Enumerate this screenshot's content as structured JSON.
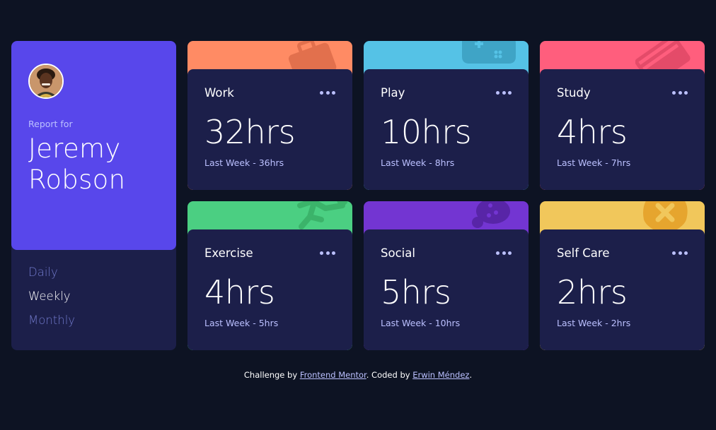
{
  "profile": {
    "report_label": "Report for",
    "first_name": "Jeremy",
    "last_name": "Robson",
    "avatar_icon": "user-avatar-photo"
  },
  "tabs": [
    {
      "label": "Daily",
      "active": false
    },
    {
      "label": "Weekly",
      "active": true
    },
    {
      "label": "Monthly",
      "active": false
    }
  ],
  "cards": [
    {
      "title": "Work",
      "current": "32hrs",
      "previous": "Last Week - 36hrs",
      "color": "#ff8b64",
      "icon": "briefcase-icon"
    },
    {
      "title": "Play",
      "current": "10hrs",
      "previous": "Last Week - 8hrs",
      "color": "#55c2e6",
      "icon": "gamepad-icon"
    },
    {
      "title": "Study",
      "current": "4hrs",
      "previous": "Last Week - 7hrs",
      "color": "#ff5e7d",
      "icon": "books-icon"
    },
    {
      "title": "Exercise",
      "current": "4hrs",
      "previous": "Last Week - 5hrs",
      "color": "#4bcf82",
      "icon": "running-icon"
    },
    {
      "title": "Social",
      "current": "5hrs",
      "previous": "Last Week - 10hrs",
      "color": "#7335d2",
      "icon": "chat-bubble-icon"
    },
    {
      "title": "Self Care",
      "current": "2hrs",
      "previous": "Last Week - 2hrs",
      "color": "#f1c75b",
      "icon": "bandage-heart-icon"
    }
  ],
  "footer": {
    "prefix": "Challenge by ",
    "link1": "Frontend Mentor",
    "middle": ". Coded by ",
    "link2": "Erwin Méndez",
    "suffix": "."
  },
  "colors": {
    "background": "#0d1323",
    "card": "#1c1f4a",
    "profile": "#5847eb",
    "muted": "#bbc0ff",
    "tab_inactive": "#7078c9"
  }
}
